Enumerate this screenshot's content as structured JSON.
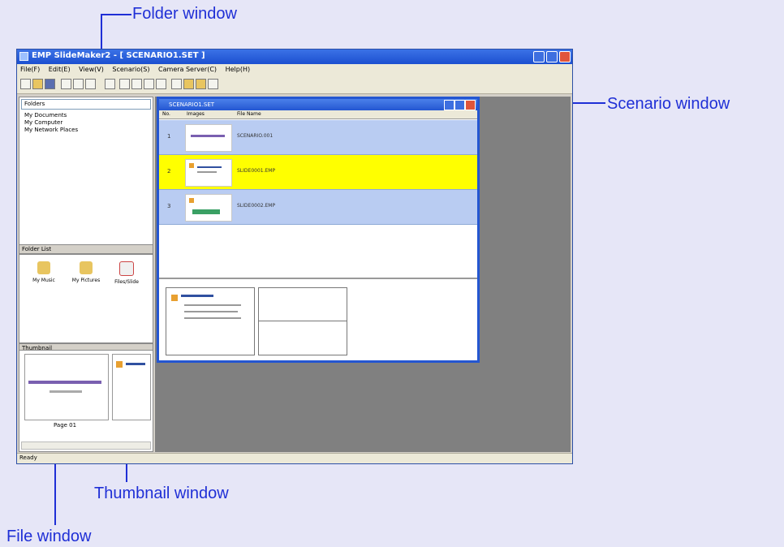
{
  "callouts": {
    "folder_window": "Folder window",
    "scenario_window": "Scenario window",
    "thumbnail_window": "Thumbnail window",
    "file_window": "File window"
  },
  "app": {
    "title": "EMP SlideMaker2 - [ SCENARIO1.SET ]",
    "menu": [
      "File(F)",
      "Edit(E)",
      "View(V)",
      "Scenario(S)",
      "Camera Server(C)",
      "Help(H)"
    ],
    "status": "Ready"
  },
  "folder": {
    "combo": "Folders",
    "tree": [
      "My Documents",
      "My Computer",
      "My Network Places"
    ]
  },
  "file_list": {
    "header": "Folder List",
    "items": [
      "My Music",
      "My Pictures",
      "Files/Slide"
    ]
  },
  "thumbnail": {
    "header": "Thumbnail",
    "caption": "Page 01"
  },
  "scenario": {
    "title": "SCENARIO1.SET",
    "columns": [
      "No.",
      "Images",
      "File Name"
    ],
    "rows": [
      {
        "no": "1",
        "file": "SCENARIO.001"
      },
      {
        "no": "2",
        "file": "SLIDE0001.EMP"
      },
      {
        "no": "3",
        "file": "SLIDE0002.EMP"
      }
    ]
  },
  "colors": {
    "callout": "#1f2fd6",
    "row_blue": "#b9ccf2",
    "row_yellow": "#ffff00",
    "mdi": "#808080"
  }
}
